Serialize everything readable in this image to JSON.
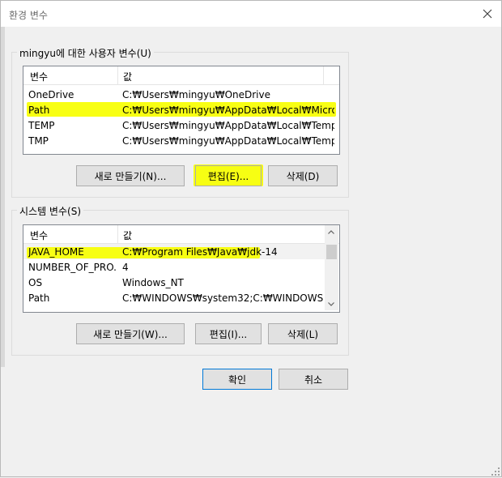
{
  "window": {
    "title": "환경 변수"
  },
  "user_vars": {
    "group_label": "mingyu에 대한 사용자 변수(U)",
    "col_name": "변수",
    "col_value": "값",
    "rows": [
      {
        "name": "OneDrive",
        "value": "C:₩Users₩mingyu₩OneDrive",
        "highlighted": false
      },
      {
        "name": "Path",
        "value": "C:₩Users₩mingyu₩AppData₩Local₩Micro...",
        "highlighted": true
      },
      {
        "name": "TEMP",
        "value": "C:₩Users₩mingyu₩AppData₩Local₩Temp",
        "highlighted": false
      },
      {
        "name": "TMP",
        "value": "C:₩Users₩mingyu₩AppData₩Local₩Temp",
        "highlighted": false
      }
    ],
    "new_label": "새로 만들기(N)...",
    "edit_label": "편집(E)...",
    "delete_label": "삭제(D)"
  },
  "system_vars": {
    "group_label": "시스템 변수(S)",
    "col_name": "변수",
    "col_value": "값",
    "rows": [
      {
        "name": "JAVA_HOME",
        "value": "C:₩Program Files₩Java₩jdk-14",
        "highlighted": true
      },
      {
        "name": "NUMBER_OF_PRO...",
        "value": "4",
        "highlighted": false
      },
      {
        "name": "OS",
        "value": "Windows_NT",
        "highlighted": false
      },
      {
        "name": "Path",
        "value": "C:₩WINDOWS₩system32;C:₩WINDOWS;C...",
        "highlighted": false
      }
    ],
    "new_label": "새로 만들기(W)...",
    "edit_label": "편집(I)...",
    "delete_label": "삭제(L)"
  },
  "footer": {
    "ok_label": "확인",
    "cancel_label": "취소"
  },
  "icons": {
    "close": "close-icon",
    "scroll_up": "chevron-up-icon",
    "scroll_down": "chevron-down-icon",
    "resize": "resize-grip-icon"
  },
  "colors": {
    "highlight": "#f7ff00",
    "selection": "#cce8ff"
  }
}
